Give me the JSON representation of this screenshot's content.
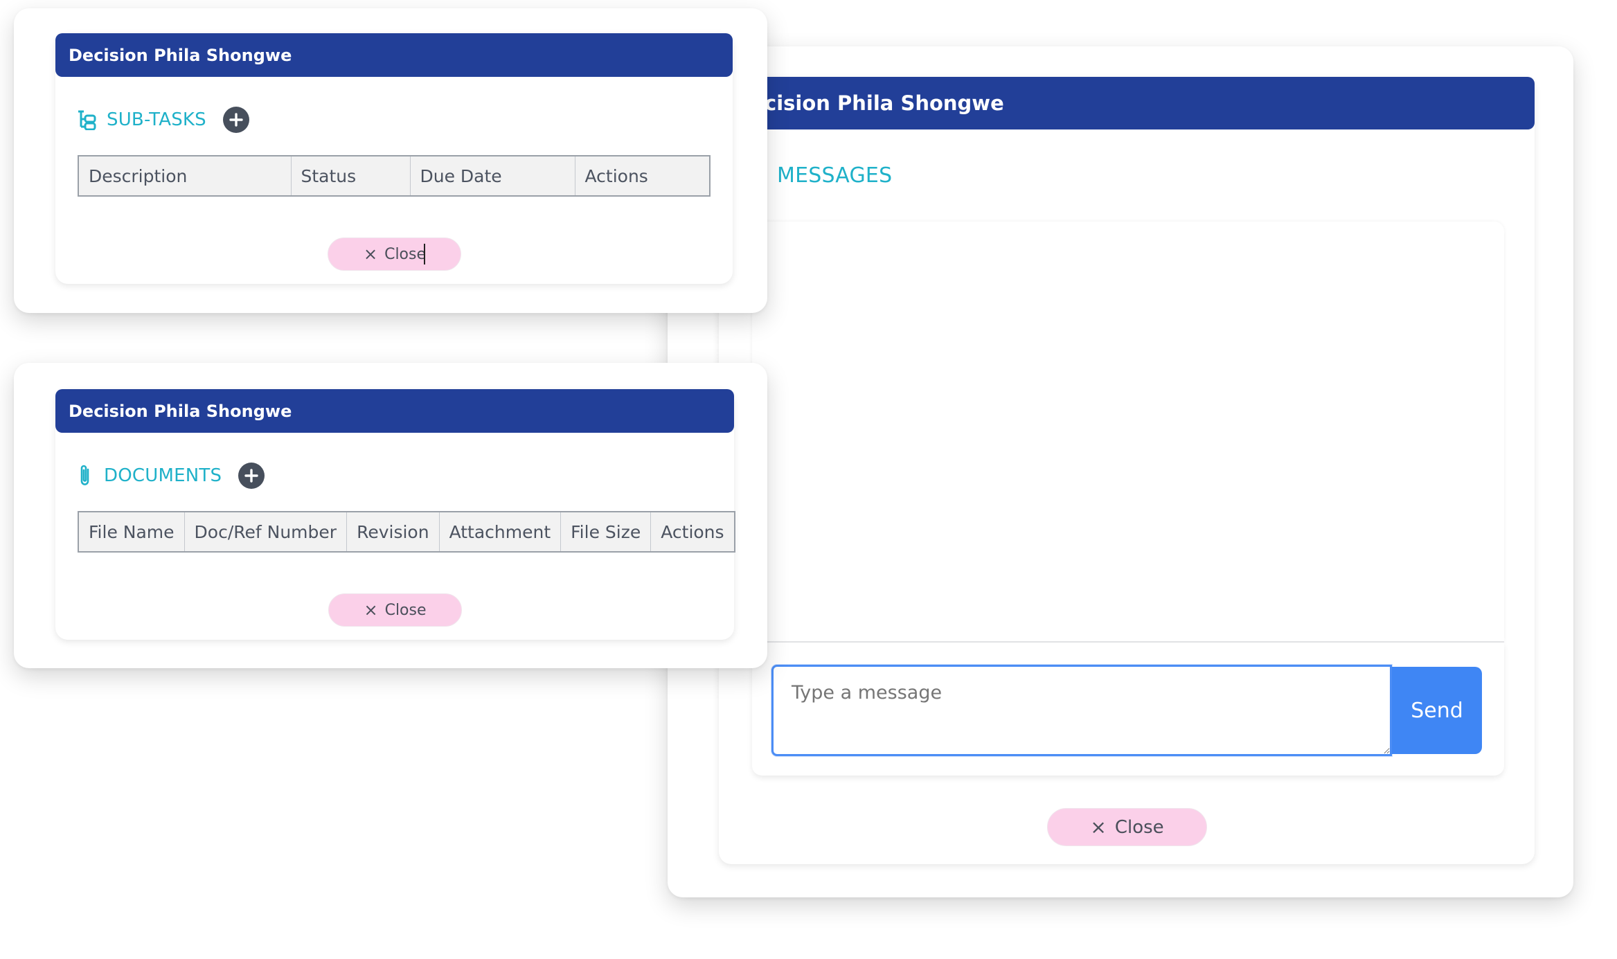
{
  "subtasks_dialog": {
    "title": "Decision Phila Shongwe",
    "section_label": "SUB-TASKS",
    "section_icon": "sitemap-icon",
    "add_icon": "plus-circle-icon",
    "columns": [
      "Description",
      "Status",
      "Due Date",
      "Actions"
    ],
    "rows": [],
    "close_icon": "×",
    "close_label": "Close"
  },
  "documents_dialog": {
    "title": "Decision Phila Shongwe",
    "section_label": "DOCUMENTS",
    "section_icon": "paperclip-icon",
    "add_icon": "plus-circle-icon",
    "columns": [
      "File Name",
      "Doc/Ref Number",
      "Revision",
      "Attachment",
      "File Size",
      "Actions"
    ],
    "rows": [],
    "close_icon": "×",
    "close_label": "Close"
  },
  "messages_dialog": {
    "title": "cision Phila Shongwe",
    "section_label": "MESSAGES",
    "messages": [],
    "input": {
      "value": "",
      "placeholder": "Type a message"
    },
    "send_label": "Send",
    "close_icon": "×",
    "close_label": "Close"
  },
  "colors": {
    "header_bg": "#223f98",
    "accent_teal": "#1fb1c9",
    "send_bg": "#3f86f4",
    "close_bg": "#fbd0e9",
    "add_btn_bg": "#474f5c"
  }
}
